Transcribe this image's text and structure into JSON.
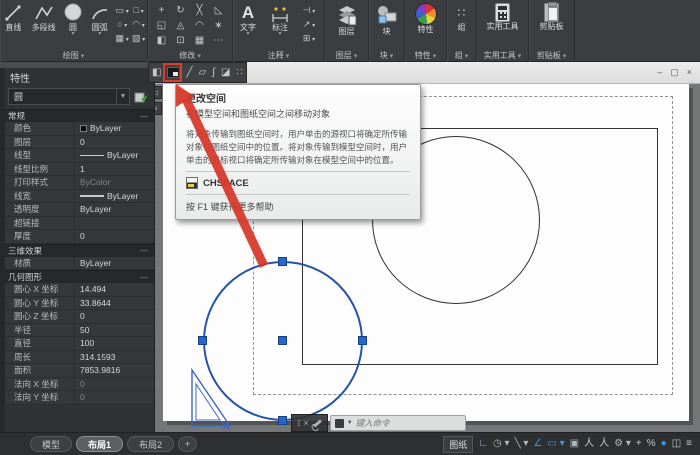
{
  "colors": {
    "selection_blue": "#2753a8",
    "grip_blue": "#2566cf",
    "arrow_red": "#d8382b",
    "status_active_blue": "#3f93e8",
    "ribbon_bg": "#3b3e41",
    "paper_white": "#fdfdfd"
  },
  "ribbon": {
    "panel_titles": [
      "绘图",
      "修改",
      "注释",
      "图层",
      "块",
      "特性",
      "组",
      "实用工具",
      "剪贴板"
    ],
    "draw": {
      "buttons": [
        {
          "label": "直线"
        },
        {
          "label": "多段线"
        },
        {
          "label": "圆"
        },
        {
          "label": "圆弧"
        }
      ],
      "small_icons": [
        {
          "name": "rectangle-icon",
          "glyph": "▭"
        },
        {
          "name": "ellipse-icon",
          "glyph": "○"
        },
        {
          "name": "hatch-icon",
          "glyph": "▦"
        },
        {
          "name": "region-icon",
          "glyph": "□"
        },
        {
          "name": "revcloud-icon",
          "glyph": "◠"
        },
        {
          "name": "gradient-icon",
          "glyph": "▨"
        }
      ]
    },
    "modify_icons": [
      {
        "name": "move-icon",
        "glyph": "+"
      },
      {
        "name": "rotate-icon",
        "glyph": "↻"
      },
      {
        "name": "trim-icon",
        "glyph": "╳"
      },
      {
        "name": "erase-icon",
        "glyph": "◺"
      },
      {
        "name": "copy-icon",
        "glyph": "◱"
      },
      {
        "name": "mirror-icon",
        "glyph": "◬"
      },
      {
        "name": "fillet-icon",
        "glyph": "◠"
      },
      {
        "name": "explode-icon",
        "glyph": "∗"
      },
      {
        "name": "stretch-icon",
        "glyph": "◧"
      },
      {
        "name": "scale-icon",
        "glyph": "⊡"
      },
      {
        "name": "array-icon",
        "glyph": "▦"
      },
      {
        "name": "more-icon",
        "glyph": "⋯"
      }
    ],
    "annotate": {
      "text_label": "文字",
      "text_glyph": "A",
      "dim_label": "标注",
      "mini_icons": [
        {
          "name": "dimstyle-icon",
          "glyph": "⊣"
        },
        {
          "name": "leader-icon",
          "glyph": "↗"
        },
        {
          "name": "table-icon",
          "glyph": "⊞"
        }
      ]
    },
    "layers_label": "图层",
    "block_label": "块",
    "props_label": "特性",
    "group_label": "组",
    "group_glyph": "∷",
    "utils_label": "实用工具",
    "clipboard_label": "剪贴板"
  },
  "window_buttons": [
    {
      "name": "minimize-icon",
      "glyph": "–"
    },
    {
      "name": "restore-icon",
      "glyph": "▢"
    },
    {
      "name": "close-icon",
      "glyph": "×"
    }
  ],
  "float_toolbar": {
    "icons": [
      {
        "name": "annotate-monitor-icon",
        "glyph": "◧"
      },
      {
        "name": "change-space-icon",
        "glyph": "",
        "highlight": true
      },
      {
        "name": "line-icon",
        "glyph": "╱"
      },
      {
        "name": "polygon-icon",
        "glyph": "▱"
      },
      {
        "name": "spline-icon",
        "glyph": "∫"
      },
      {
        "name": "edit-hatch-icon",
        "glyph": "◪"
      },
      {
        "name": "points-icon",
        "glyph": "∷"
      }
    ]
  },
  "side_buttons": [
    {
      "name": "autohide-icon",
      "glyph": "▭"
    },
    {
      "name": "palette-menu-icon",
      "glyph": "≡"
    }
  ],
  "properties_panel": {
    "title": "特性",
    "selector_value": "圆",
    "sections": [
      {
        "header": "常规",
        "rows": [
          {
            "label": "颜色",
            "value": "ByLayer",
            "swatch": true
          },
          {
            "label": "图层",
            "value": "0"
          },
          {
            "label": "线型",
            "value": "ByLayer",
            "line": "thin"
          },
          {
            "label": "线型比例",
            "value": "1"
          },
          {
            "label": "打印样式",
            "value": "ByColor",
            "dim": true
          },
          {
            "label": "线宽",
            "value": "ByLayer",
            "line": "thick"
          },
          {
            "label": "透明度",
            "value": "ByLayer"
          },
          {
            "label": "超链接",
            "value": ""
          },
          {
            "label": "厚度",
            "value": "0"
          }
        ]
      },
      {
        "header": "三维效果",
        "rows": [
          {
            "label": "材质",
            "value": "ByLayer"
          }
        ]
      },
      {
        "header": "几何图形",
        "rows": [
          {
            "label": "圆心 X 坐标",
            "value": "14.494"
          },
          {
            "label": "圆心 Y 坐标",
            "value": "33.8644"
          },
          {
            "label": "圆心 Z 坐标",
            "value": "0"
          },
          {
            "label": "半径",
            "value": "50"
          },
          {
            "label": "直径",
            "value": "100"
          },
          {
            "label": "周长",
            "value": "314.1593"
          },
          {
            "label": "面积",
            "value": "7853.9816"
          },
          {
            "label": "法向 X 坐标",
            "value": "0",
            "dim": true
          },
          {
            "label": "法向 Y 坐标",
            "value": "0",
            "dim": true
          }
        ]
      }
    ]
  },
  "tooltip": {
    "title": "更改空间",
    "subtitle": "在模型空间和图纸空间之间移动对象",
    "body": "将对象传输到图纸空间时，用户单击的源视口将确定所传输对象在图纸空间中的位置。将对象传输到模型空间时，用户单击的目标视口将确定所传输对象在模型空间中的位置。",
    "command": "CHSPACE",
    "help": "按 F1 键获得更多帮助"
  },
  "command_bar": {
    "close_glyph": "×",
    "placeholder": "键入命令"
  },
  "layout_tabs": [
    {
      "label": "模型",
      "active": false
    },
    {
      "label": "布局1",
      "active": true
    },
    {
      "label": "布局2",
      "active": false
    },
    {
      "label": "+",
      "active": false,
      "new": true
    }
  ],
  "status_bar": {
    "paper_label": "图纸",
    "icons": [
      {
        "name": "snap-icon",
        "glyph": "∟",
        "color": "#8fb4d4"
      },
      {
        "name": "drafting-settings-icon",
        "glyph": "◷",
        "color": "#aeb8bd",
        "dd": true
      },
      {
        "name": "ortho-icon",
        "glyph": "╲",
        "color": "#aeb8bd",
        "dd": true
      },
      {
        "name": "polar-tracking-icon",
        "glyph": "∠",
        "color": "#3f93e8"
      },
      {
        "name": "osnap-icon",
        "glyph": "▭",
        "color": "#3f93e8",
        "dd": true
      },
      {
        "name": "lock-icon",
        "glyph": "▣",
        "color": "#aeb8bd"
      },
      {
        "name": "annotation-visibility-icon",
        "glyph": "人",
        "color": "#c6cacc"
      },
      {
        "name": "annotation-autoscale-icon",
        "glyph": "人",
        "color": "#c6cacc"
      },
      {
        "name": "annotation-scale-icon",
        "glyph": "⚙",
        "color": "#aeb8bd",
        "dd": true
      },
      {
        "name": "workspace-plus-icon",
        "glyph": "+",
        "color": "#c6cacc"
      },
      {
        "name": "isolate-objects-icon",
        "glyph": "%",
        "color": "#c6cacc"
      },
      {
        "name": "hardware-accel-icon",
        "glyph": "●",
        "color": "#3f93e8"
      },
      {
        "name": "display-icon",
        "glyph": "◫",
        "color": "#c6cacc"
      },
      {
        "name": "customize-icon",
        "glyph": "≡",
        "color": "#c6cacc"
      }
    ]
  }
}
